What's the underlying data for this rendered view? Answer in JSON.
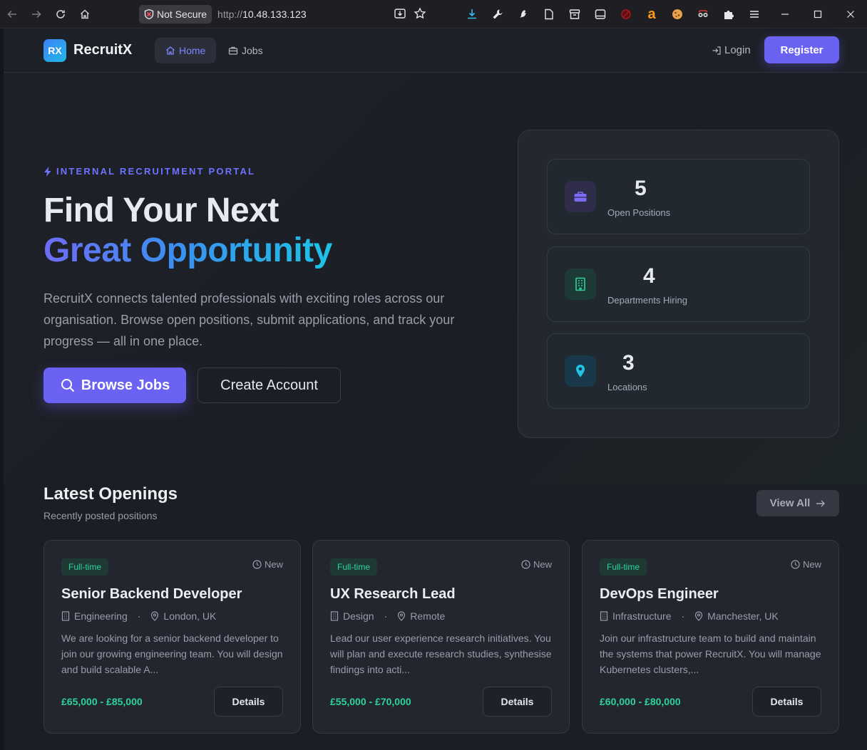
{
  "browser": {
    "security_label": "Not Secure",
    "url_scheme": "http://",
    "url_host": "10.48.133.123"
  },
  "nav": {
    "brand_mark": "RX",
    "brand_name": "RecruitX",
    "home_label": "Home",
    "jobs_label": "Jobs",
    "login_label": "Login",
    "register_label": "Register"
  },
  "hero": {
    "eyebrow": "INTERNAL RECRUITMENT PORTAL",
    "headline_line1": "Find Your Next",
    "headline_line2": "Great Opportunity",
    "lead": "RecruitX connects talented professionals with exciting roles across our organisation. Browse open positions, submit applications, and track your progress — all in one place.",
    "browse_label": "Browse Jobs",
    "create_label": "Create Account"
  },
  "stats": [
    {
      "value": "5",
      "label": "Open Positions",
      "icon": "briefcase-icon",
      "color": "#7b6cf6"
    },
    {
      "value": "4",
      "label": "Departments Hiring",
      "icon": "building-icon",
      "color": "#2ed39b"
    },
    {
      "value": "3",
      "label": "Locations",
      "icon": "map-pin-icon",
      "color": "#22c3e6"
    }
  ],
  "latest": {
    "title": "Latest Openings",
    "subtitle": "Recently posted positions",
    "view_all_label": "View All"
  },
  "jobs": [
    {
      "type": "Full-time",
      "tag": "New",
      "title": "Senior Backend Developer",
      "department": "Engineering",
      "location": "London, UK",
      "description": "We are looking for a senior backend developer to join our growing engineering team. You will design and build scalable A...",
      "salary": "£65,000 - £85,000",
      "details_label": "Details"
    },
    {
      "type": "Full-time",
      "tag": "New",
      "title": "UX Research Lead",
      "department": "Design",
      "location": "Remote",
      "description": "Lead our user experience research initiatives. You will plan and execute research studies, synthesise findings into acti...",
      "salary": "£55,000 - £70,000",
      "details_label": "Details"
    },
    {
      "type": "Full-time",
      "tag": "New",
      "title": "DevOps Engineer",
      "department": "Infrastructure",
      "location": "Manchester, UK",
      "description": "Join our infrastructure team to build and maintain the systems that power RecruitX. You will manage Kubernetes clusters,...",
      "salary": "£60,000 - £80,000",
      "details_label": "Details"
    }
  ],
  "colors": {
    "accent": "#6a62f2",
    "success": "#2ed39b",
    "background": "#1c1e25"
  }
}
